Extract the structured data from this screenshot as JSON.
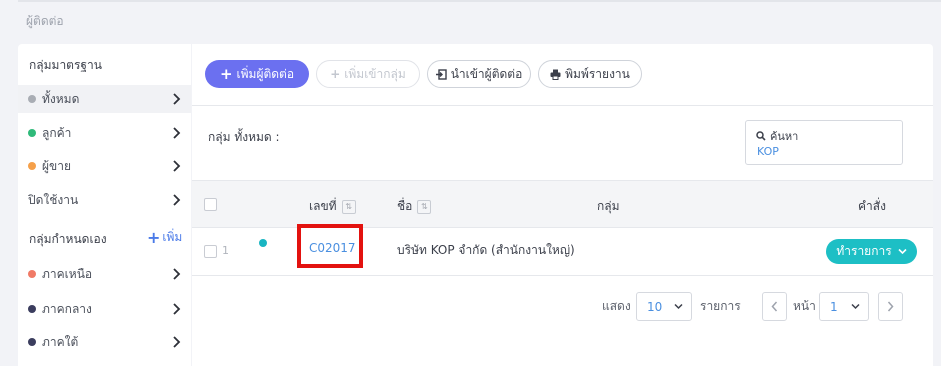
{
  "page": {
    "title": "ผู้ติดต่อ"
  },
  "sidebar": {
    "standard_heading": "กลุ่มมาตรฐาน",
    "standard_items": [
      {
        "label": "ทั้งหมด",
        "dot_color": "#a9adb4"
      },
      {
        "label": "ลูกค้า",
        "dot_color": "#2fba7a"
      },
      {
        "label": "ผู้ขาย",
        "dot_color": "#f5a04a"
      },
      {
        "label": "ปิดใช้งาน",
        "dot_color": ""
      }
    ],
    "custom_heading": "กลุ่มกำหนดเอง",
    "add_label": "เพิ่ม",
    "custom_items": [
      {
        "label": "ภาคเหนือ",
        "dot_color": "#f07a66"
      },
      {
        "label": "ภาคกลาง",
        "dot_color": "#3b3d5e"
      },
      {
        "label": "ภาคใต้",
        "dot_color": "#3b3d5e"
      }
    ]
  },
  "toolbar": {
    "add_contact": "เพิ่มผู้ติดต่อ",
    "add_to_group": "เพิ่มเข้ากลุ่ม",
    "import_contacts": "นำเข้าผู้ติดต่อ",
    "print_report": "พิมพ์รายงาน"
  },
  "filter": {
    "group_label": "กลุ่ม ทั้งหมด :",
    "search_label": "ค้นหา",
    "search_value": "KOP"
  },
  "table": {
    "columns": {
      "code": "เลขที่",
      "name": "ชื่อ",
      "group": "กลุ่ม",
      "actions": "คำสั่ง"
    },
    "rows": [
      {
        "index": "1",
        "code": "C02017",
        "name": "บริษัท KOP จำกัด (สำนักงานใหญ่)",
        "group": "",
        "action_label": "ทำรายการ"
      }
    ]
  },
  "pagination": {
    "show_label": "แสดง",
    "per_page": "10",
    "items_label": "รายการ",
    "page_label": "หน้า",
    "current_page": "1"
  }
}
